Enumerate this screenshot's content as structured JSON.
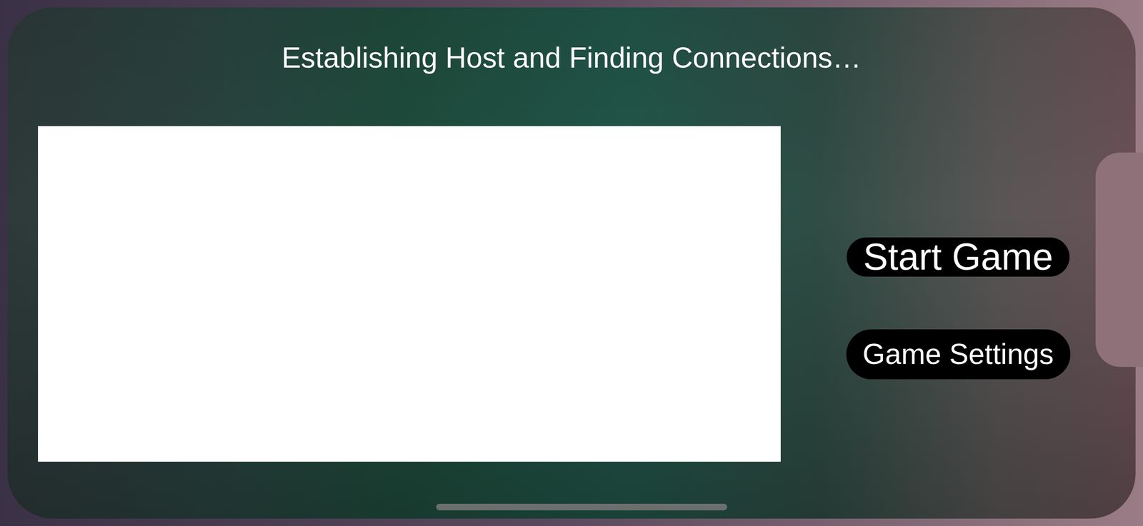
{
  "screen": {
    "title": "Establishing Host and Finding Connections…"
  },
  "connections": [],
  "buttons": [
    {
      "label": "Start Game",
      "kind": "primary"
    },
    {
      "label": "Game Settings",
      "kind": "secondary"
    }
  ]
}
